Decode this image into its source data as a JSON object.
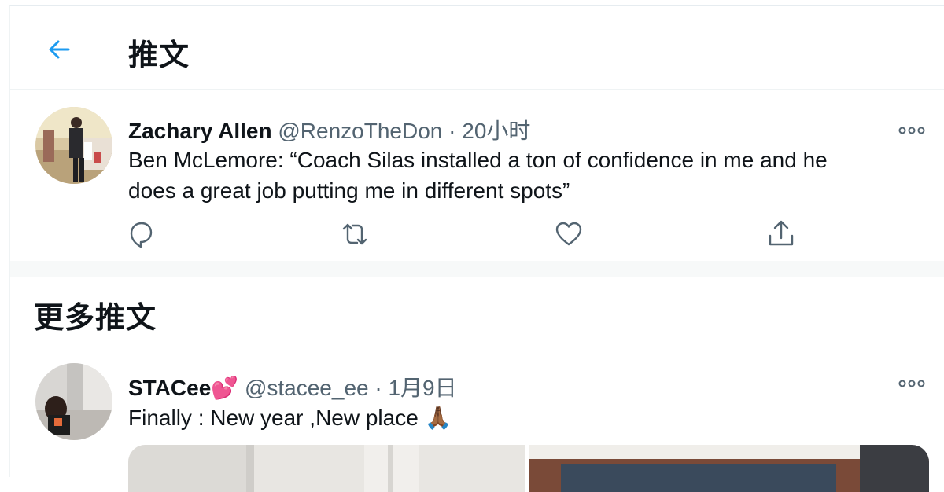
{
  "header": {
    "title": "推文"
  },
  "tweet": {
    "name": "Zachary Allen",
    "handle": "@RenzoTheDon",
    "separator": "·",
    "time": "20小时",
    "text_line1": "Ben McLemore: “Coach Silas installed a ton of confidence in me and he",
    "text_line2": "does a great job putting me in different spots”"
  },
  "more_section": {
    "title": "更多推文"
  },
  "tweet2": {
    "name": "STACee",
    "emoji": "💕",
    "handle": "@stacee_ee",
    "separator": "·",
    "time": "1月9日",
    "text": "Finally : New year ,New place",
    "text_emoji": "🙏🏾"
  },
  "colors": {
    "accent": "#1d9bf0",
    "muted": "#536471",
    "text": "#0f1419"
  }
}
